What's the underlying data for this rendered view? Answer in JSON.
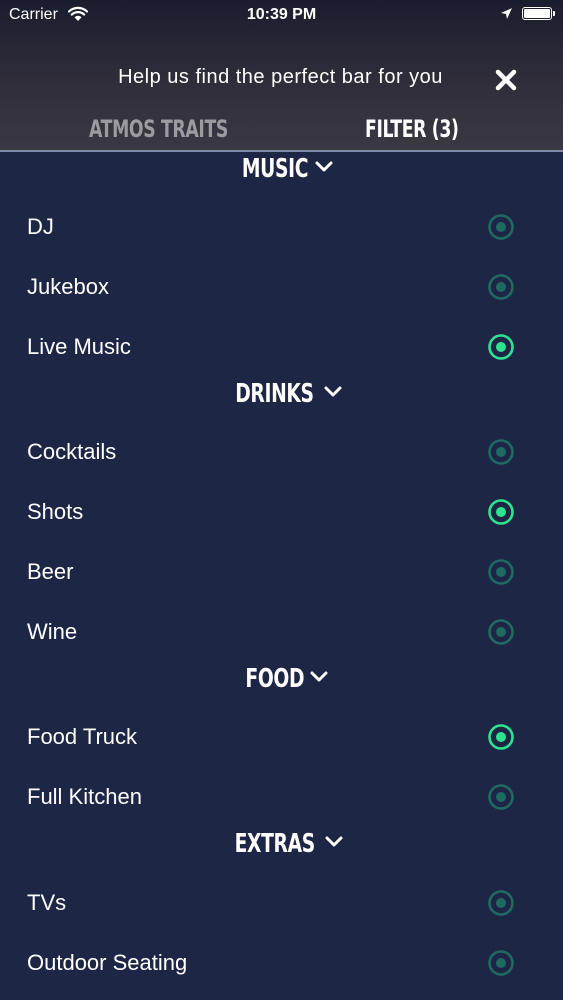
{
  "status_bar": {
    "carrier": "Carrier",
    "time": "10:39 PM",
    "wifi_icon": "wifi-icon",
    "location_icon": "location-arrow-icon",
    "battery_icon": "battery-icon"
  },
  "header": {
    "message": "Help us find the perfect bar for you",
    "close_icon": "close-icon"
  },
  "tabs": [
    {
      "label": "ATMOS TRAITS",
      "active": false
    },
    {
      "label": "FILTER (3)",
      "active": true
    }
  ],
  "colors": {
    "background": "#1d2645",
    "accent": "#2ee38f",
    "inactive_radio": "#1f6b62",
    "tab_inactive": "#9b9ba0"
  },
  "sections": [
    {
      "title": "MUSIC",
      "items": [
        {
          "label": "DJ",
          "selected": false
        },
        {
          "label": "Jukebox",
          "selected": false
        },
        {
          "label": "Live Music",
          "selected": true
        }
      ]
    },
    {
      "title": "DRINKS",
      "items": [
        {
          "label": "Cocktails",
          "selected": false
        },
        {
          "label": "Shots",
          "selected": true
        },
        {
          "label": "Beer",
          "selected": false
        },
        {
          "label": "Wine",
          "selected": false
        }
      ]
    },
    {
      "title": "FOOD",
      "items": [
        {
          "label": "Food Truck",
          "selected": true
        },
        {
          "label": "Full Kitchen",
          "selected": false
        }
      ]
    },
    {
      "title": "EXTRAS",
      "items": [
        {
          "label": "TVs",
          "selected": false
        },
        {
          "label": "Outdoor Seating",
          "selected": false
        }
      ]
    }
  ]
}
